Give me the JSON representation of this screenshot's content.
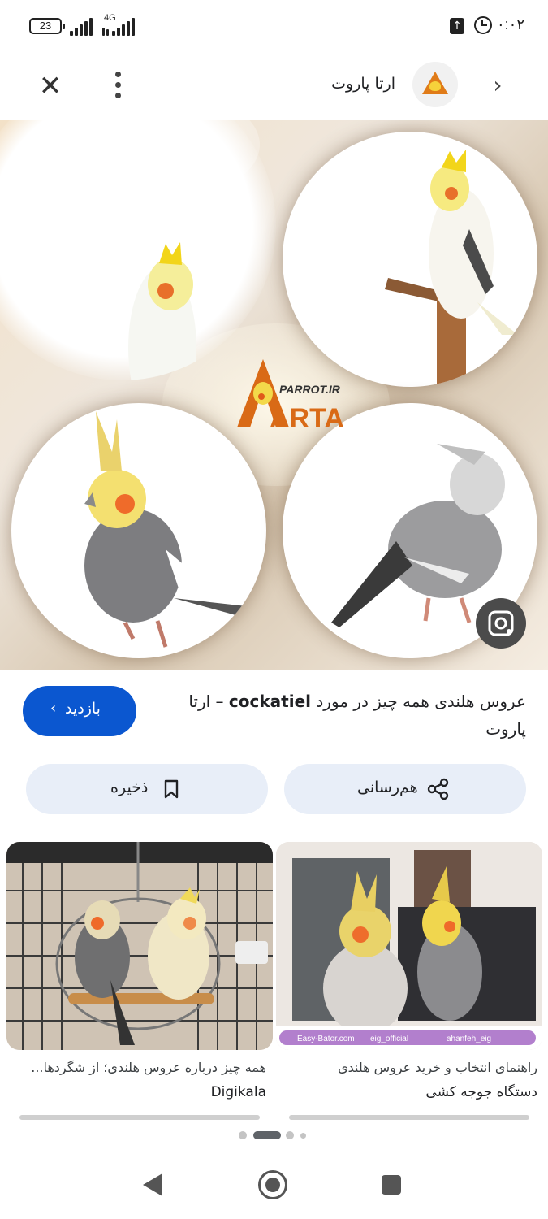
{
  "status_bar": {
    "battery": "23",
    "network": "4G",
    "time": "۰:۰۲"
  },
  "header": {
    "site_title": "ارتا پاروت",
    "close_icon": "close-icon",
    "more_icon": "more-vert-icon",
    "next_icon": "chevron-right-icon"
  },
  "main_image": {
    "watermark_brand": "ARTA",
    "watermark_domain": "PARROT.IR",
    "lens_icon": "google-lens-icon"
  },
  "result": {
    "title_prefix": "عروس هلندی همه چیز در مورد",
    "title_bold": "cockatiel",
    "title_suffix": "– ارتا پاروت",
    "visit_label": "بازدید"
  },
  "actions": {
    "share_label": "هم‌رسانی",
    "save_label": "ذخیره"
  },
  "related": [
    {
      "title": "راهنمای انتخاب و خرید عروس هلندی",
      "source": "دستگاه جوجه کشی",
      "watermark": [
        "Easy-Bator.com",
        "eig_official",
        "ahanfeh_eig"
      ]
    },
    {
      "title": "همه چیز درباره عروس هلندی؛ از شگردها...",
      "source": "Digikala"
    }
  ],
  "colors": {
    "accent": "#0b57d0",
    "pill_bg": "#e8eef8"
  }
}
